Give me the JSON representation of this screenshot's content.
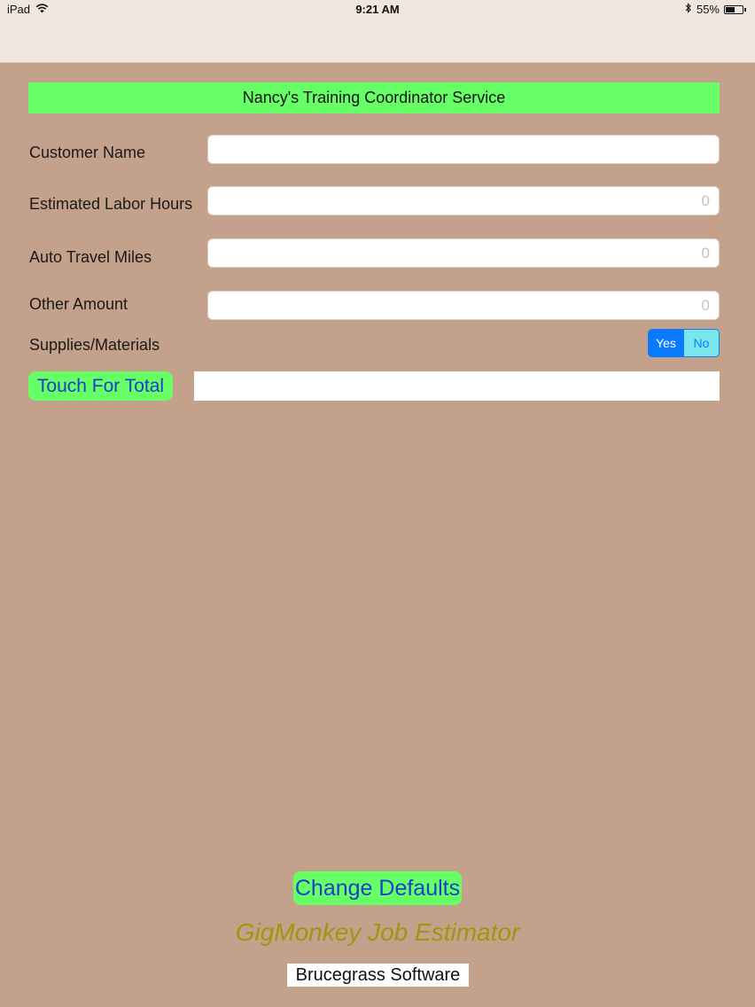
{
  "status_bar": {
    "device": "iPad",
    "time": "9:21 AM",
    "battery": "55%",
    "battery_level": 0.55
  },
  "header": {
    "title": "Nancy's Training Coordinator Service"
  },
  "form": {
    "customer_name_label": "Customer Name",
    "customer_name_value": "",
    "labor_hours_label": "Estimated Labor Hours",
    "labor_hours_placeholder": "0",
    "travel_miles_label": "Auto Travel Miles",
    "travel_miles_placeholder": "0",
    "other_amount_label": "Other Amount",
    "other_amount_placeholder": "0",
    "supplies_label": "Supplies/Materials",
    "supplies_options": [
      "Yes",
      "No"
    ],
    "supplies_selected": "Yes"
  },
  "total": {
    "button_label": "Touch For Total",
    "value": ""
  },
  "footer": {
    "defaults_button": "Change Defaults",
    "app_name": "GigMonkey Job Estimator",
    "company": "Brucegrass Software"
  },
  "colors": {
    "background": "#c4a18b",
    "accent_green": "#66ff66",
    "button_text": "#1a3fc9",
    "segment_selected": "#0a7bff",
    "app_name": "#a5930d"
  }
}
